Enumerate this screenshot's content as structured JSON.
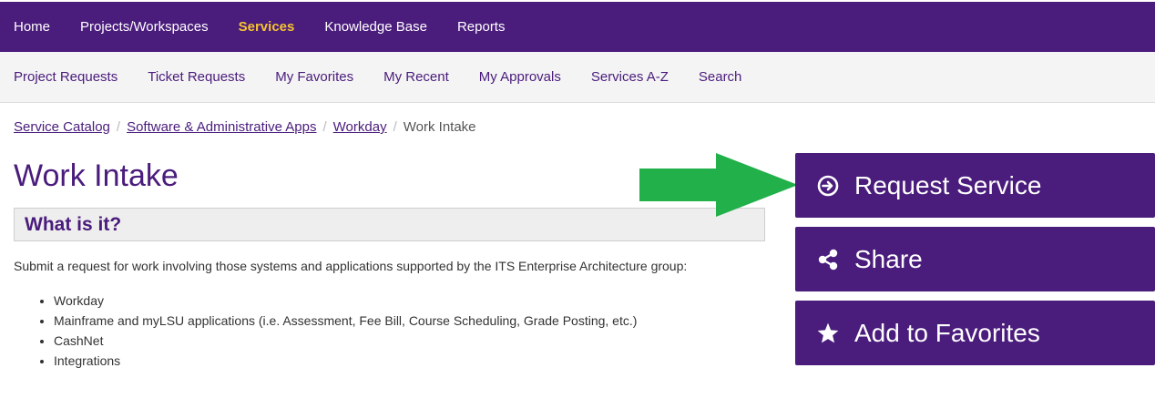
{
  "top_nav": {
    "items": [
      {
        "label": "Home"
      },
      {
        "label": "Projects/Workspaces"
      },
      {
        "label": "Services",
        "active": true
      },
      {
        "label": "Knowledge Base"
      },
      {
        "label": "Reports"
      }
    ],
    "background_color": "#4a1c7c",
    "active_color": "#f5c430"
  },
  "sub_nav": {
    "items": [
      {
        "label": "Project Requests"
      },
      {
        "label": "Ticket Requests"
      },
      {
        "label": "My Favorites"
      },
      {
        "label": "My Recent"
      },
      {
        "label": "My Approvals"
      },
      {
        "label": "Services A-Z"
      },
      {
        "label": "Search"
      }
    ]
  },
  "breadcrumb": {
    "items": [
      {
        "label": "Service Catalog"
      },
      {
        "label": "Software & Administrative Apps"
      },
      {
        "label": "Workday"
      }
    ],
    "current": "Work Intake",
    "separator": "/"
  },
  "page": {
    "title": "Work Intake",
    "section_heading": "What is it?",
    "description": "Submit a request for work involving those systems and applications supported by the ITS Enterprise Architecture group:",
    "bullets": [
      "Workday",
      "Mainframe and myLSU applications (i.e. Assessment, Fee Bill, Course Scheduling, Grade Posting, etc.)",
      "CashNet",
      "Integrations"
    ]
  },
  "actions": {
    "request_service": {
      "label": "Request Service",
      "icon": "arrow-circle-right-icon"
    },
    "share": {
      "label": "Share",
      "icon": "share-icon"
    },
    "add_to_favorites": {
      "label": "Add to Favorites",
      "icon": "star-icon"
    }
  },
  "annotation": {
    "arrow_color": "#22b04b",
    "arrow_icon": "green-arrow-icon"
  }
}
